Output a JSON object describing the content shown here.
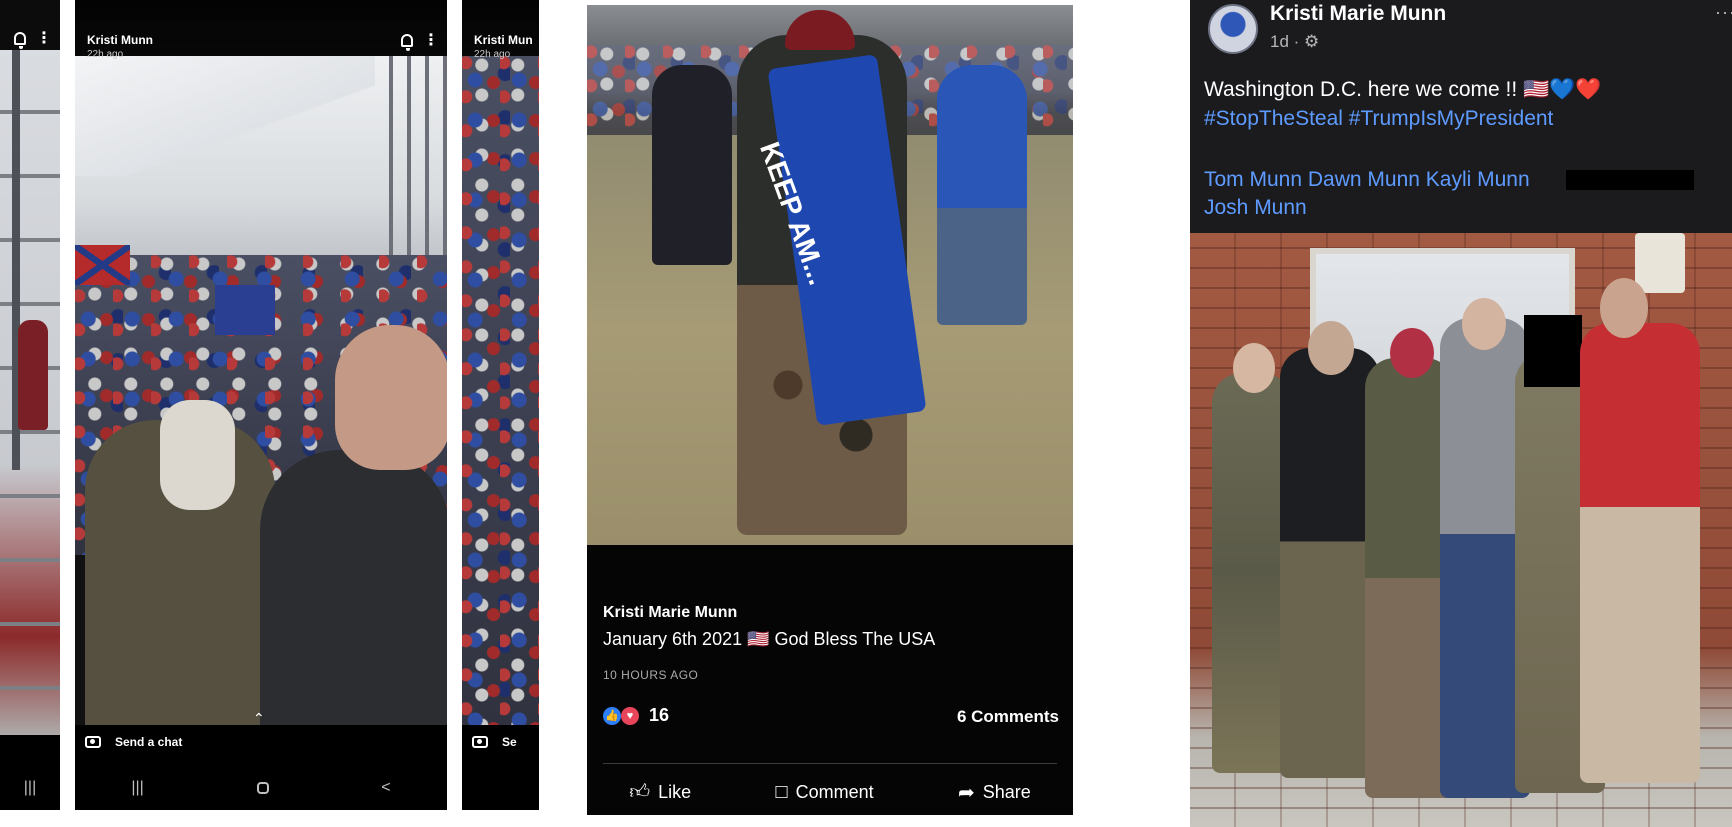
{
  "snap_left": {
    "nav": {
      "recents": "|||"
    }
  },
  "snap_main": {
    "username": "Kristi Munn",
    "time": "22h ago",
    "chat_placeholder": "Send a chat",
    "nav": {
      "recents": "|||",
      "back": "<"
    }
  },
  "snap_right": {
    "username": "Kristi Mun",
    "time": "22h ago",
    "chat_placeholder": "Se"
  },
  "mid_post": {
    "author": "Kristi Marie Munn",
    "text": "January 6th 2021 🇺🇸 God Bless The USA",
    "time": "10 HOURS AGO",
    "reaction_count": "16",
    "comments": "6 Comments",
    "actions": {
      "like": "Like",
      "comment": "Comment",
      "share": "Share"
    },
    "flag_text": "KEEP AM..."
  },
  "fb_post": {
    "author": "Kristi Marie Munn",
    "meta": "1d · ⚙",
    "more": "···",
    "line1": "Washington D.C. here we come !! 🇺🇸💙❤️",
    "hashtags": "#StopTheSteal #TrumpIsMyPresident",
    "tagged_line1": "Tom Munn Dawn Munn Kayli Munn",
    "tagged_line2": "Josh Munn"
  },
  "colors": {
    "fb_blue": "#5e9bff",
    "like_blue": "#2d7ff9",
    "love_red": "#e8455a"
  }
}
